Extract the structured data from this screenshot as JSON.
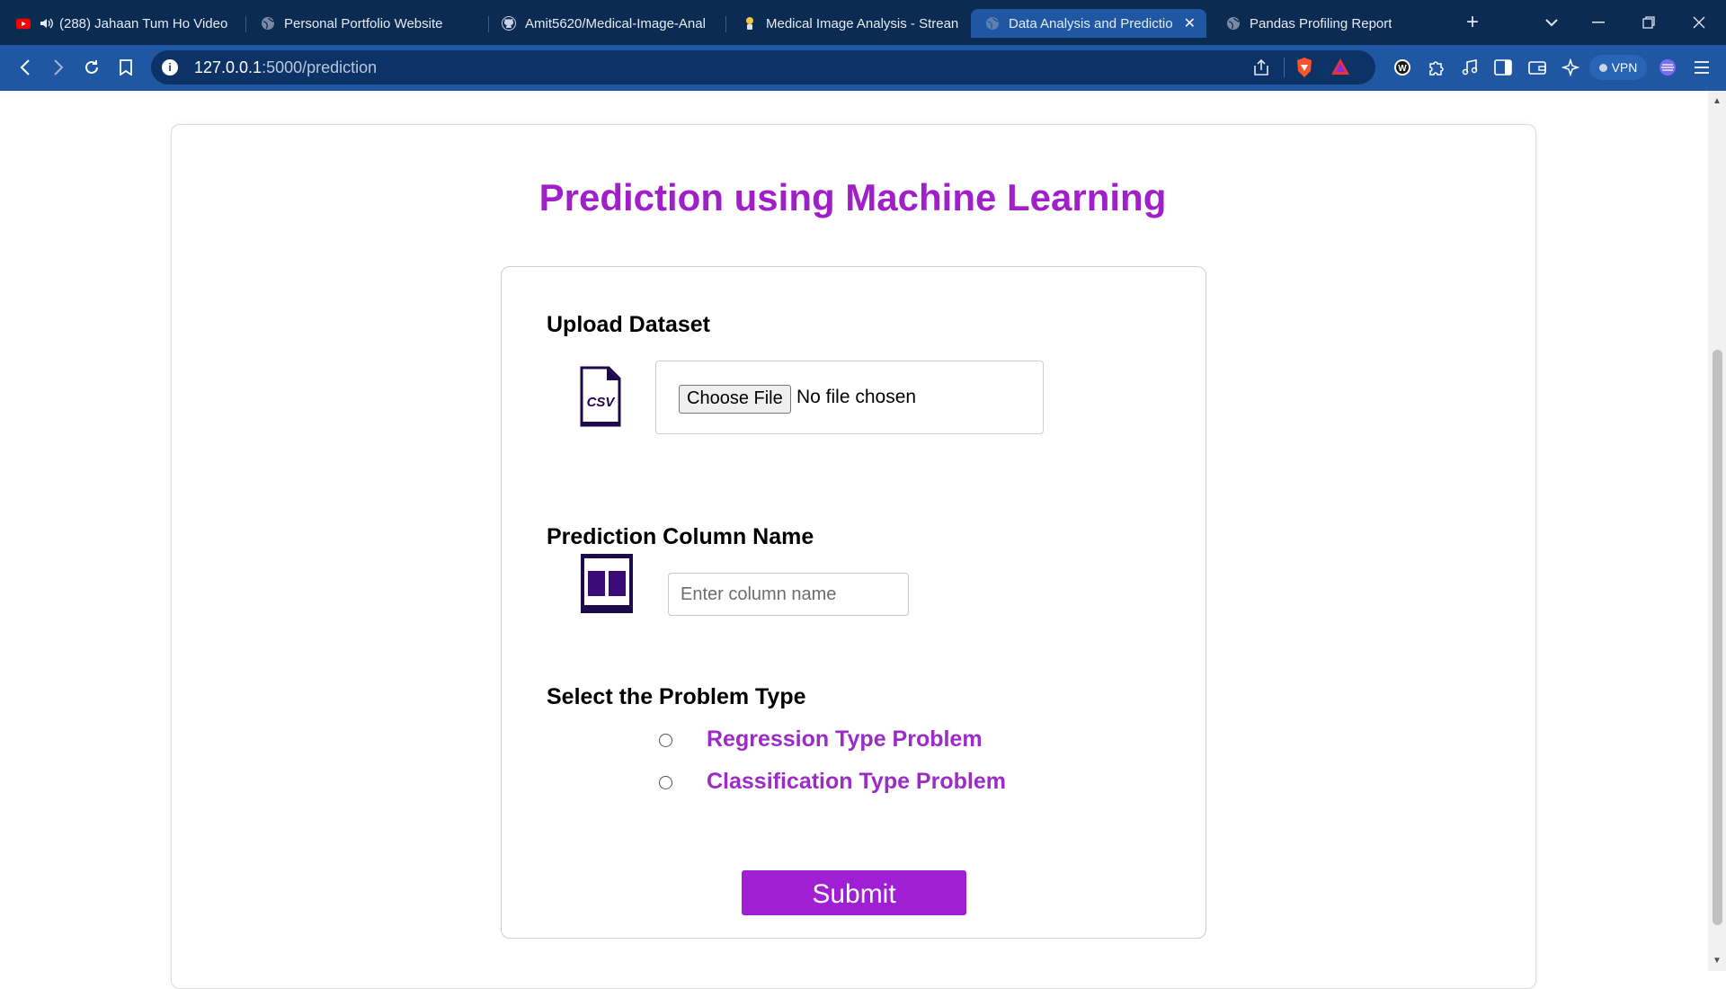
{
  "browser": {
    "tabs": [
      {
        "title": "(288) Jahaan Tum Ho Video",
        "icon": "youtube-icon"
      },
      {
        "title": "Personal Portfolio Website",
        "icon": "globe-icon"
      },
      {
        "title": "Amit5620/Medical-Image-Anal",
        "icon": "github-icon"
      },
      {
        "title": "Medical Image Analysis - Strean",
        "icon": "streamlit-icon"
      },
      {
        "title": "Data Analysis and Predictio",
        "icon": "globe-icon",
        "active": true
      },
      {
        "title": "Pandas Profiling Report",
        "icon": "globe-icon"
      }
    ],
    "new_tab_label": "+",
    "url_host": "127.0.0.1",
    "url_path": ":5000/prediction",
    "vpn_label": "VPN",
    "colors": {
      "tabbar": "#0b2b52",
      "toolbar": "#1f57a3",
      "accent_purple": "#a01fd3"
    }
  },
  "page": {
    "title": "Prediction using Machine Learning",
    "upload": {
      "label": "Upload Dataset",
      "icon": "csv-file-icon",
      "icon_text": "CSV",
      "button_label": "Choose File",
      "status": "No file chosen"
    },
    "column": {
      "label": "Prediction Column Name",
      "icon": "columns-icon",
      "placeholder": "Enter column name",
      "value": ""
    },
    "problem": {
      "label": "Select the Problem Type",
      "options": [
        {
          "label": "Regression Type Problem",
          "selected": false
        },
        {
          "label": "Classification Type Problem",
          "selected": false
        }
      ]
    },
    "submit_label": "Submit"
  }
}
